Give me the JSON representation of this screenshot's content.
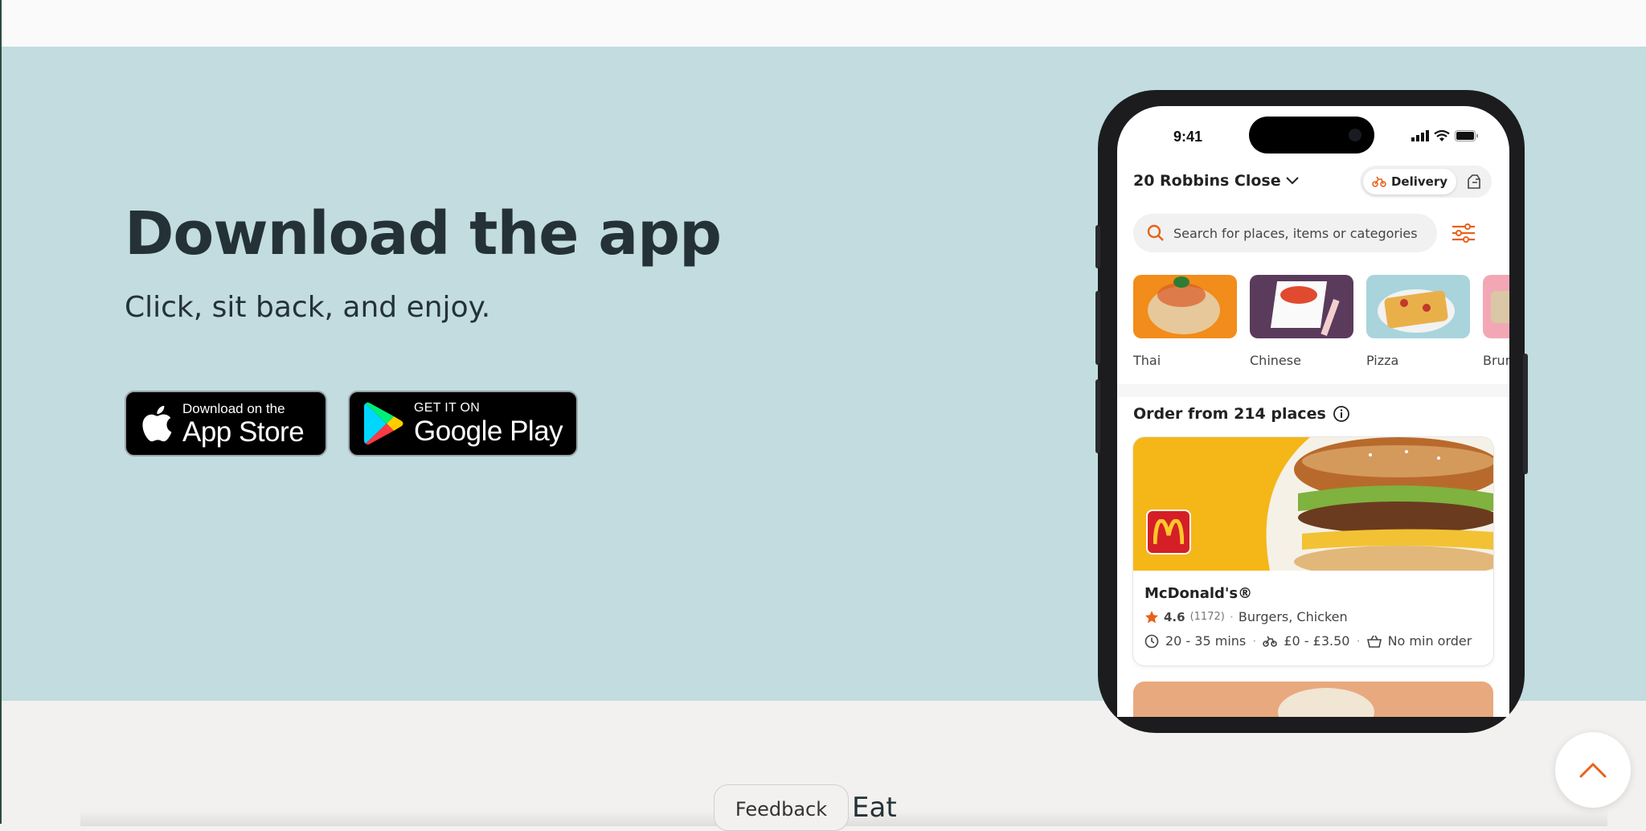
{
  "hero": {
    "headline": "Download the app",
    "subline": "Click, sit back, and enjoy.",
    "app_store": {
      "small": "Download on the",
      "big": "App Store"
    },
    "google_play": {
      "small": "GET IT ON",
      "big": "Google Play"
    }
  },
  "phone": {
    "status_time": "9:41",
    "address": "20 Robbins Close",
    "mode_label": "Delivery",
    "search_placeholder": "Search for places, items or categories",
    "categories": [
      {
        "label": "Thai"
      },
      {
        "label": "Chinese"
      },
      {
        "label": "Pizza"
      },
      {
        "label": "Brun"
      }
    ],
    "order_title": "Order from 214 places",
    "restaurant": {
      "name": "McDonald's®",
      "rating": "4.6",
      "reviews": "(1172)",
      "cuisine": "Burgers, Chicken",
      "time": "20 - 35 mins",
      "fee": "£0 - £3.50",
      "min_order": "No min order"
    }
  },
  "footer": {
    "partial_text": "Eat",
    "feedback_label": "Feedback"
  },
  "colors": {
    "hero_bg": "#c2dcdf",
    "accent": "#e8611a",
    "dark_text": "#243238"
  }
}
